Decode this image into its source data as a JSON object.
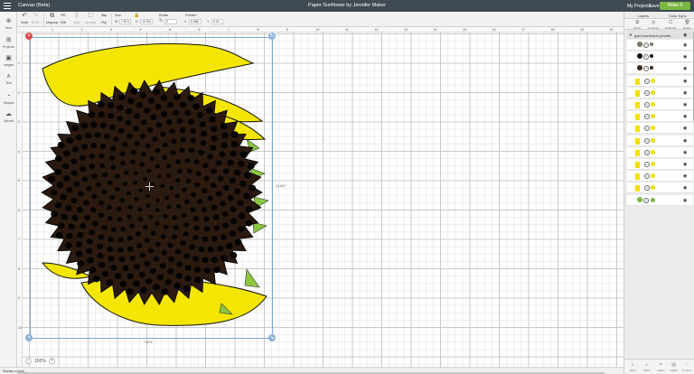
{
  "topbar": {
    "app_name": "Canvas (Beta)",
    "project_title": "Paper Sunflower by Jennifer Maker",
    "my_projects": "My Projects",
    "save": "Save",
    "make_it": "Make It"
  },
  "toolbar": {
    "undo": "Undo",
    "redo": "Redo",
    "ungroup": "Ungroup",
    "edit": "Edit",
    "align": "Align",
    "arrange": "Arrange",
    "flip": "Flip",
    "size_label": "Size",
    "w_label": "W",
    "w_value": "7.874",
    "h_label": "H",
    "h_value": "10.011",
    "rotate_label": "Rotate",
    "rotate_value": "0",
    "position_label": "Position",
    "x_label": "X",
    "x_value": "0.366",
    "y_label": "Y",
    "y_value": "0.21"
  },
  "leftpanel": {
    "items": [
      "New",
      "Projects",
      "Images",
      "Text",
      "Shapes",
      "Upload"
    ]
  },
  "rulers": {
    "top": [
      "1",
      "2",
      "3",
      "4",
      "5",
      "6",
      "7",
      "8",
      "9",
      "10",
      "11",
      "12",
      "13",
      "14",
      "15",
      "16",
      "17",
      "18",
      "19",
      "20"
    ],
    "left": [
      "1",
      "2",
      "3",
      "4",
      "5",
      "6",
      "7",
      "8",
      "9",
      "10"
    ]
  },
  "canvas": {
    "width_dim": "7.874\"",
    "height_dim": "10.011\""
  },
  "zoom": {
    "value": "150%"
  },
  "statusbar": {
    "text": "Display a menu"
  },
  "rightpanel": {
    "tabs": [
      "Layers",
      "Color Sync"
    ],
    "tools": [
      "Group",
      "UnGroup",
      "Duplicate",
      "Delete"
    ],
    "group_name": "giant-sunflower-jennife...",
    "layer_colors": [
      "#7d7466",
      "#111111",
      "#3a2a1c",
      "#f4e000",
      "#f4e000",
      "#f4e000",
      "#f4e000",
      "#f4e000",
      "#f4e000",
      "#f4e000",
      "#f4e000",
      "#f4e000",
      "#f4e000",
      "#7ab640"
    ],
    "bottom_tools": [
      "Slice",
      "Weld",
      "Attach",
      "Flatten",
      "Contour"
    ]
  },
  "colors": {
    "petal": "#f4e600",
    "center": "#2b1a10",
    "seed": "#060403",
    "leaf": "#8cc63f",
    "make_button": "#7ab640",
    "topbar": "#3f4a53"
  }
}
